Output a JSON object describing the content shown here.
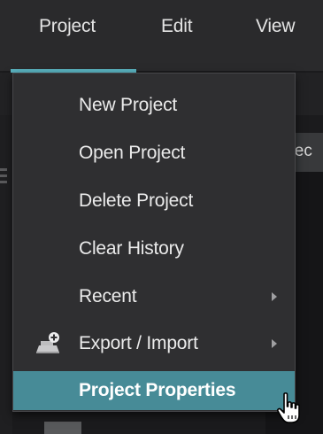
{
  "menubar": {
    "items": [
      {
        "label": "Project"
      },
      {
        "label": "Edit"
      },
      {
        "label": "View"
      }
    ]
  },
  "background": {
    "toolbar_text": "elec"
  },
  "dropdown": {
    "items": [
      {
        "label": "New Project"
      },
      {
        "label": "Open Project"
      },
      {
        "label": "Delete Project"
      },
      {
        "label": "Clear History"
      },
      {
        "label": "Recent",
        "submenu": true
      },
      {
        "label": "Export / Import",
        "submenu": true,
        "icon": "export-import-icon"
      },
      {
        "label": "Project Properties",
        "highlighted": true
      }
    ]
  },
  "colors": {
    "accent": "#5ab3c1",
    "highlight": "#478b97",
    "menu_bg": "#2f2f31"
  },
  "cursor": {
    "icon": "hand-pointer-icon"
  }
}
